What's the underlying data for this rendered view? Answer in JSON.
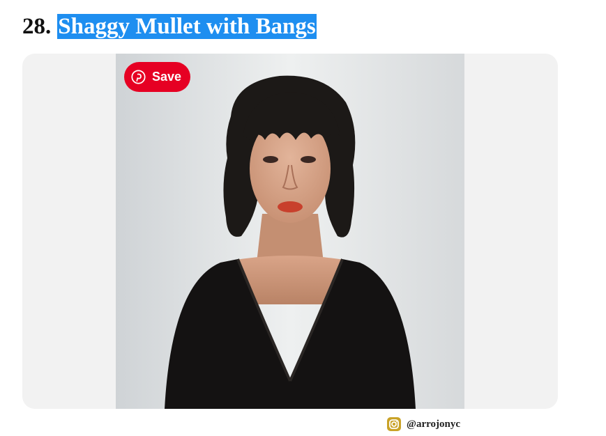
{
  "article": {
    "number": "28.",
    "title": "Shaggy Mullet with Bangs"
  },
  "image": {
    "alt": "Shaggy Mullet with Bangs",
    "save_label": "Save",
    "save_icon": "pinterest-icon",
    "credit_icon": "instagram-icon",
    "credit_handle": "@arrojonyc"
  },
  "colors": {
    "selection_highlight": "#1e8ef0",
    "pinterest_red": "#e60023",
    "instagram_badge": "#c9a227",
    "frame_background": "#f2f2f2"
  }
}
